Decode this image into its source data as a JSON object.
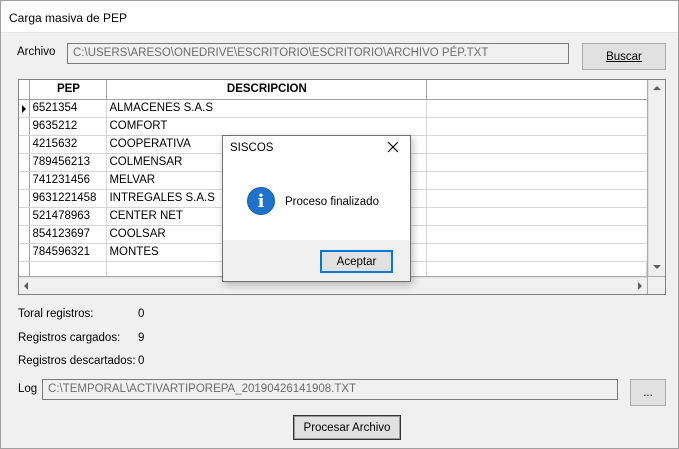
{
  "window": {
    "title": "Carga masiva de PEP"
  },
  "archivo": {
    "label": "Archivo",
    "value": "C:\\USERS\\ARESO\\ONEDRIVE\\ESCRITORIO\\ESCRITORIO\\ARCHIVO PÉP.TXT",
    "button_label": "Buscar"
  },
  "grid": {
    "columns": [
      "PEP",
      "DESCRIPCION"
    ],
    "rows": [
      {
        "pep": "6521354",
        "descripcion": "ALMACENES S.A.S"
      },
      {
        "pep": "9635212",
        "descripcion": "COMFORT"
      },
      {
        "pep": "4215632",
        "descripcion": "COOPERATIVA"
      },
      {
        "pep": "789456213",
        "descripcion": "COLMENSAR"
      },
      {
        "pep": "741231456",
        "descripcion": "MELVAR"
      },
      {
        "pep": "9631221458",
        "descripcion": "INTREGALES S.A.S"
      },
      {
        "pep": "521478963",
        "descripcion": "CENTER NET"
      },
      {
        "pep": "854123697",
        "descripcion": "COOLSAR"
      },
      {
        "pep": "784596321",
        "descripcion": "MONTES"
      }
    ]
  },
  "stats": {
    "total_label": "Toral registros:",
    "total_value": "0",
    "cargados_label": "Registros cargados:",
    "cargados_value": "9",
    "descartados_label": "Registros descartados:",
    "descartados_value": "0"
  },
  "log": {
    "label": "Log",
    "value": "C:\\TEMPORAL\\ACTIVARTIPOREPA_20190426141908.TXT",
    "button_label": "..."
  },
  "process_button": "Procesar Archivo",
  "dialog": {
    "title": "SISCOS",
    "message": "Proceso finalizado",
    "ok_label": "Aceptar",
    "icon": "info-icon"
  }
}
